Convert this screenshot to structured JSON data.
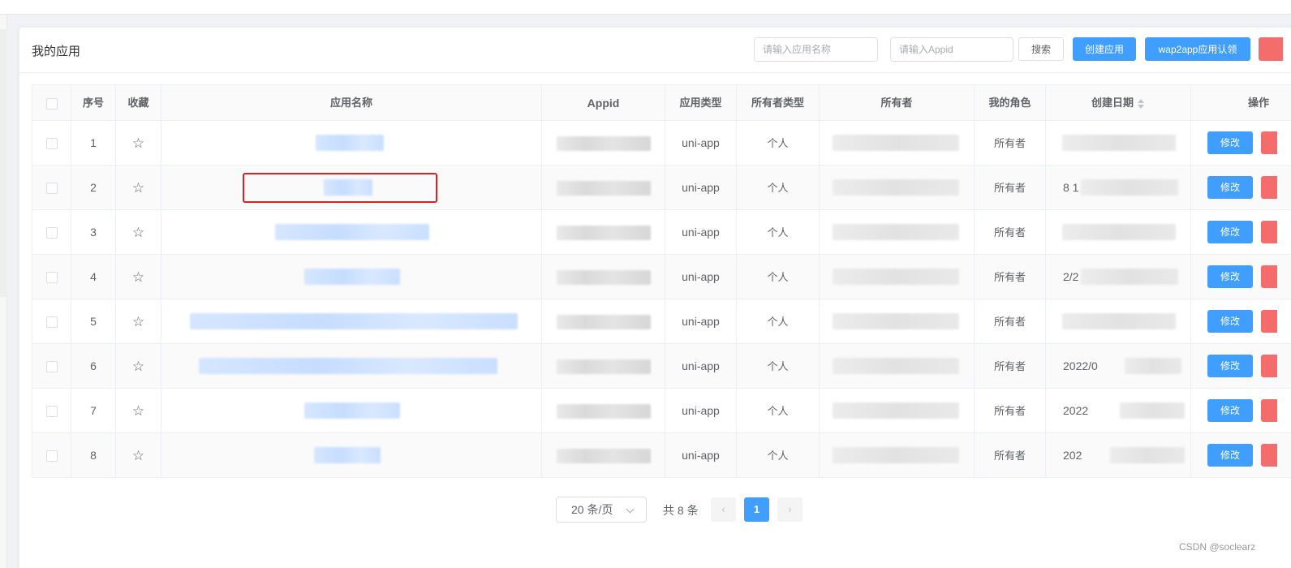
{
  "header": {
    "title": "我的应用",
    "search_name_placeholder": "请输入应用名称",
    "search_appid_placeholder": "请输入Appid",
    "search_label": "搜索",
    "create_label": "创建应用",
    "wap2app_label": "wap2app应用认领"
  },
  "table": {
    "columns": {
      "index": "序号",
      "favorite": "收藏",
      "name": "应用名称",
      "appid": "Appid",
      "type": "应用类型",
      "owner_type": "所有者类型",
      "owner": "所有者",
      "role": "我的角色",
      "created": "创建日期",
      "actions": "操作"
    },
    "rows": [
      {
        "index": "1",
        "type": "uni-app",
        "owner_type": "个人",
        "role": "所有者",
        "created_partial": "",
        "edit_label": "修改"
      },
      {
        "index": "2",
        "type": "uni-app",
        "owner_type": "个人",
        "role": "所有者",
        "created_partial": "8 1",
        "edit_label": "修改"
      },
      {
        "index": "3",
        "type": "uni-app",
        "owner_type": "个人",
        "role": "所有者",
        "created_partial": "",
        "edit_label": "修改"
      },
      {
        "index": "4",
        "type": "uni-app",
        "owner_type": "个人",
        "role": "所有者",
        "created_partial": "2/2",
        "edit_label": "修改"
      },
      {
        "index": "5",
        "type": "uni-app",
        "owner_type": "个人",
        "role": "所有者",
        "created_partial": "",
        "edit_label": "修改"
      },
      {
        "index": "6",
        "type": "uni-app",
        "owner_type": "个人",
        "role": "所有者",
        "created_partial": "2022/0",
        "edit_label": "修改"
      },
      {
        "index": "7",
        "type": "uni-app",
        "owner_type": "个人",
        "role": "所有者",
        "created_partial": "2022",
        "edit_label": "修改"
      },
      {
        "index": "8",
        "type": "uni-app",
        "owner_type": "个人",
        "role": "所有者",
        "created_partial": "202",
        "edit_label": "修改"
      }
    ]
  },
  "pagination": {
    "page_size": "20 条/页",
    "total": "共 8 条",
    "current_page": "1",
    "prev": "‹",
    "next": "›"
  },
  "watermark": "CSDN @soclearz",
  "colors": {
    "primary": "#409eff",
    "danger": "#f56c6c",
    "highlight": "#e02020"
  }
}
